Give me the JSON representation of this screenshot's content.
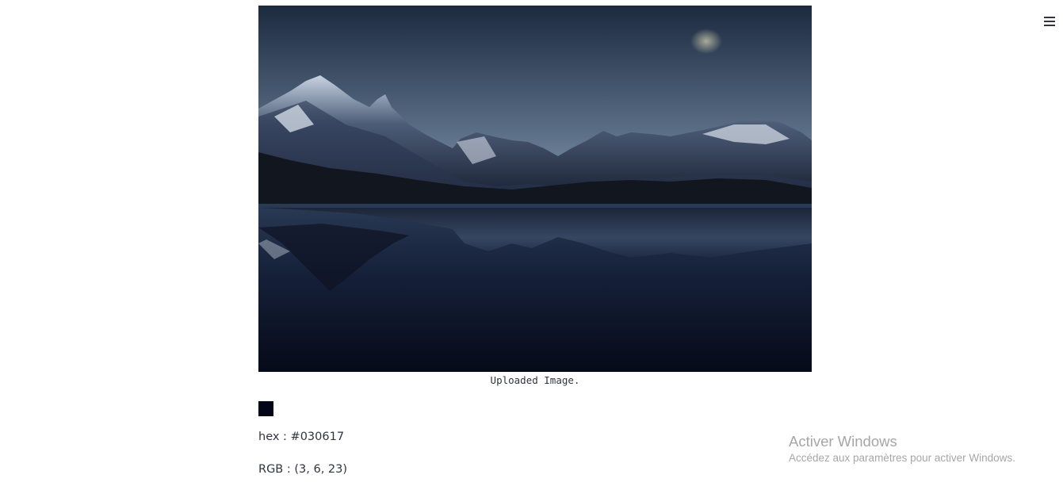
{
  "menu": {
    "icon": "hamburger-menu-icon"
  },
  "image": {
    "caption": "Uploaded Image.",
    "description_icon": "mountain-lake-photo"
  },
  "color_result": {
    "swatch_color": "#030617",
    "hex_text": "hex : #030617",
    "rgb_text": "RGB : (3, 6, 23)"
  },
  "watermark": {
    "title": "Activer Windows",
    "subtitle": "Accédez aux paramètres pour activer Windows."
  }
}
